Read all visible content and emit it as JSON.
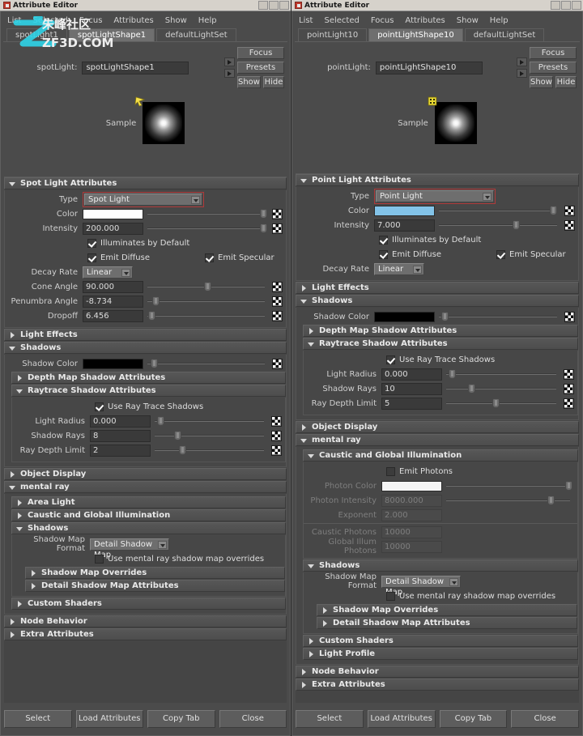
{
  "watermark": {
    "cn": "朱峰社区",
    "url": "ZF3D.COM",
    "glyph": "之"
  },
  "windows": [
    {
      "id": "left",
      "title": "Attribute Editor",
      "menu": [
        "List",
        "Selected",
        "Focus",
        "Attributes",
        "Show",
        "Help"
      ],
      "tabs": [
        {
          "label": "spotLight1",
          "active": false
        },
        {
          "label": "spotLightShape1",
          "active": true
        },
        {
          "label": "defaultLightSet",
          "active": false
        }
      ],
      "node": {
        "label": "spotLight:",
        "value": "spotLightShape1"
      },
      "actions": {
        "focus": "Focus",
        "presets": "Presets",
        "show": "Show",
        "hide": "Hide"
      },
      "sample_label": "Sample",
      "sections": [
        {
          "title": "Spot Light Attributes",
          "open": true,
          "level": 0,
          "rows": [
            {
              "kind": "combo",
              "label": "Type",
              "value": "Spot Light",
              "highlight": true,
              "width": "wide"
            },
            {
              "kind": "color",
              "label": "Color",
              "value": "#ffffff",
              "slider": 96,
              "map": true
            },
            {
              "kind": "field",
              "label": "Intensity",
              "value": "200.000",
              "slider": 96,
              "map": true
            },
            {
              "kind": "check",
              "label": "Illuminates by Default",
              "checked": true
            },
            {
              "kind": "check2",
              "label": "Emit Diffuse",
              "checked": true,
              "label2": "Emit Specular",
              "checked2": true
            },
            {
              "kind": "combo",
              "label": "Decay Rate",
              "value": "Linear",
              "width": "sm"
            },
            {
              "kind": "field",
              "label": "Cone Angle",
              "value": "90.000",
              "slider": 48,
              "map": true
            },
            {
              "kind": "field",
              "label": "Penumbra Angle",
              "value": "-8.734",
              "slider": 4,
              "map": true
            },
            {
              "kind": "field",
              "label": "Dropoff",
              "value": "6.456",
              "slider": 1,
              "map": true
            }
          ]
        },
        {
          "title": "Light Effects",
          "open": false,
          "level": 0,
          "rows": []
        },
        {
          "title": "Shadows",
          "open": true,
          "level": 0,
          "rows": [
            {
              "kind": "color",
              "label": "Shadow Color",
              "value": "#000000",
              "slider": 3,
              "map": true
            }
          ],
          "children": [
            {
              "title": "Depth Map Shadow Attributes",
              "open": false,
              "level": 1,
              "rows": []
            },
            {
              "title": "Raytrace Shadow Attributes",
              "open": true,
              "level": 1,
              "rows": [
                {
                  "kind": "check",
                  "label": "Use Ray Trace Shadows",
                  "checked": true
                },
                {
                  "kind": "field",
                  "label": "Light Radius",
                  "value": "0.000",
                  "slider": 2,
                  "map": true
                },
                {
                  "kind": "field",
                  "label": "Shadow Rays",
                  "value": "8",
                  "slider": 18,
                  "map": true
                },
                {
                  "kind": "field",
                  "label": "Ray Depth Limit",
                  "value": "2",
                  "slider": 22,
                  "map": true
                }
              ]
            }
          ]
        },
        {
          "title": "Object Display",
          "open": false,
          "level": 0,
          "rows": []
        },
        {
          "title": "mental ray",
          "open": true,
          "level": 0,
          "rows": [],
          "children": [
            {
              "title": "Area Light",
              "open": false,
              "level": 1,
              "rows": []
            },
            {
              "title": "Caustic and Global Illumination",
              "open": false,
              "level": 1,
              "rows": []
            },
            {
              "title": "Shadows",
              "open": true,
              "level": 1,
              "rows": [
                {
                  "kind": "combo",
                  "label": "Shadow Map Format",
                  "value": "Detail Shadow Map",
                  "width": "md"
                },
                {
                  "kind": "check",
                  "label": "Use mental ray shadow map overrides",
                  "checked": false
                }
              ],
              "children": [
                {
                  "title": "Shadow Map Overrides",
                  "open": false,
                  "level": 2,
                  "rows": []
                },
                {
                  "title": "Detail Shadow Map Attributes",
                  "open": false,
                  "level": 2,
                  "rows": []
                }
              ]
            },
            {
              "title": "Custom Shaders",
              "open": false,
              "level": 1,
              "rows": []
            }
          ]
        },
        {
          "title": "Node Behavior",
          "open": false,
          "level": 0,
          "rows": []
        },
        {
          "title": "Extra Attributes",
          "open": false,
          "level": 0,
          "rows": []
        }
      ],
      "footer": [
        "Select",
        "Load Attributes",
        "Copy Tab",
        "Close"
      ]
    },
    {
      "id": "right",
      "title": "Attribute Editor",
      "menu": [
        "List",
        "Selected",
        "Focus",
        "Attributes",
        "Show",
        "Help"
      ],
      "tabs": [
        {
          "label": "pointLight10",
          "active": false
        },
        {
          "label": "pointLightShape10",
          "active": true
        },
        {
          "label": "defaultLightSet",
          "active": false
        }
      ],
      "node": {
        "label": "pointLight:",
        "value": "pointLightShape10"
      },
      "actions": {
        "focus": "Focus",
        "presets": "Presets",
        "show": "Show",
        "hide": "Hide"
      },
      "sample_label": "Sample",
      "sections": [
        {
          "title": "Point Light Attributes",
          "open": true,
          "level": 0,
          "rows": [
            {
              "kind": "combo",
              "label": "Type",
              "value": "Point Light",
              "highlight": true,
              "width": "wide"
            },
            {
              "kind": "color",
              "label": "Color",
              "value": "#83c3e8",
              "slider": 94,
              "map": true
            },
            {
              "kind": "field",
              "label": "Intensity",
              "value": "7.000",
              "slider": 62,
              "map": true
            },
            {
              "kind": "check",
              "label": "Illuminates by Default",
              "checked": true
            },
            {
              "kind": "check2",
              "label": "Emit Diffuse",
              "checked": true,
              "label2": "Emit Specular",
              "checked2": true
            },
            {
              "kind": "combo",
              "label": "Decay Rate",
              "value": "Linear",
              "width": "sm"
            }
          ]
        },
        {
          "title": "Light Effects",
          "open": false,
          "level": 0,
          "rows": []
        },
        {
          "title": "Shadows",
          "open": true,
          "level": 0,
          "rows": [
            {
              "kind": "color",
              "label": "Shadow Color",
              "value": "#000000",
              "slider": 2,
              "map": true
            }
          ],
          "children": [
            {
              "title": "Depth Map Shadow Attributes",
              "open": false,
              "level": 1,
              "rows": []
            },
            {
              "title": "Raytrace Shadow Attributes",
              "open": true,
              "level": 1,
              "rows": [
                {
                  "kind": "check",
                  "label": "Use Ray Trace Shadows",
                  "checked": true
                },
                {
                  "kind": "field",
                  "label": "Light Radius",
                  "value": "0.000",
                  "slider": 2,
                  "map": true
                },
                {
                  "kind": "field",
                  "label": "Shadow Rays",
                  "value": "10",
                  "slider": 20,
                  "map": true
                },
                {
                  "kind": "field",
                  "label": "Ray Depth Limit",
                  "value": "5",
                  "slider": 42,
                  "map": true
                }
              ]
            }
          ]
        },
        {
          "title": "Object Display",
          "open": false,
          "level": 0,
          "rows": []
        },
        {
          "title": "mental ray",
          "open": true,
          "level": 0,
          "rows": [],
          "children": [
            {
              "title": "Caustic and Global Illumination",
              "open": true,
              "level": 1,
              "rows": [
                {
                  "kind": "check",
                  "label": "Emit Photons",
                  "checked": false
                },
                {
                  "kind": "color",
                  "label": "Photon Color",
                  "value": "#ffffff",
                  "slider": 100,
                  "map": false,
                  "dim": true
                },
                {
                  "kind": "field",
                  "label": "Photon Intensity",
                  "value": "8000.000",
                  "slider": 82,
                  "map": false,
                  "dim": true
                },
                {
                  "kind": "field",
                  "label": "Exponent",
                  "value": "2.000",
                  "dim": true
                },
                {
                  "kind": "sep"
                },
                {
                  "kind": "field",
                  "label": "Caustic Photons",
                  "value": "10000",
                  "dim": true
                },
                {
                  "kind": "field",
                  "label": "Global Illum Photons",
                  "value": "10000",
                  "dim": true
                }
              ]
            },
            {
              "title": "Shadows",
              "open": true,
              "level": 1,
              "rows": [
                {
                  "kind": "combo",
                  "label": "Shadow Map Format",
                  "value": "Detail Shadow Map",
                  "width": "md"
                },
                {
                  "kind": "check",
                  "label": "Use mental ray shadow map overrides",
                  "checked": false
                }
              ],
              "children": [
                {
                  "title": "Shadow Map Overrides",
                  "open": false,
                  "level": 2,
                  "rows": []
                },
                {
                  "title": "Detail Shadow Map Attributes",
                  "open": false,
                  "level": 2,
                  "rows": []
                }
              ]
            },
            {
              "title": "Custom Shaders",
              "open": false,
              "level": 1,
              "rows": []
            },
            {
              "title": "Light Profile",
              "open": false,
              "level": 1,
              "rows": []
            }
          ]
        },
        {
          "title": "Node Behavior",
          "open": false,
          "level": 0,
          "rows": []
        },
        {
          "title": "Extra Attributes",
          "open": false,
          "level": 0,
          "rows": []
        }
      ],
      "footer": [
        "Select",
        "Load Attributes",
        "Copy Tab",
        "Close"
      ]
    }
  ]
}
